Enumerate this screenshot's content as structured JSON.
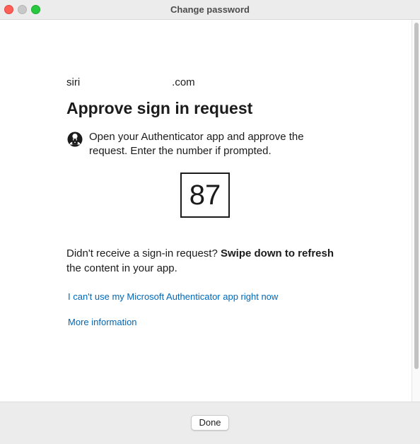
{
  "window": {
    "title": "Change password"
  },
  "account": {
    "prefix": "siri",
    "suffix": ".com"
  },
  "heading": "Approve sign in request",
  "instruction": {
    "icon": "authenticator-lock-icon",
    "text": "Open your Authenticator app and approve the request. Enter the number if prompted."
  },
  "number": "87",
  "hint": {
    "prefix": "Didn't receive a sign-in request?",
    "bold": "Swipe down to refresh",
    "suffix": "the content in your app."
  },
  "links": {
    "cant_use": "I can't use my Microsoft Authenticator app right now",
    "more_info": "More information"
  },
  "footer": {
    "done_label": "Done"
  },
  "colors": {
    "link": "#0067b8",
    "close": "#ff5f57",
    "zoom": "#28c840"
  }
}
